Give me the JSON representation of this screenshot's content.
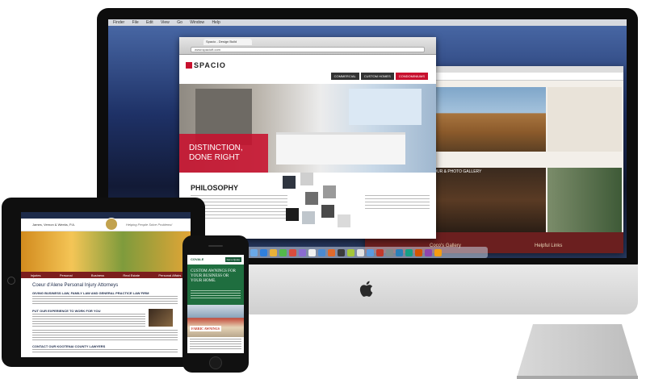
{
  "imac": {
    "menubar": [
      "Finder",
      "File",
      "Edit",
      "View",
      "Go",
      "Window",
      "Help"
    ],
    "dock_colors": [
      "#6aa9e9",
      "#2f7fdc",
      "#e8b23a",
      "#53b84b",
      "#d94c3d",
      "#8a6bd1",
      "#f1f1f1",
      "#4b8ad1",
      "#e06a2c",
      "#3b3b3b",
      "#a4c639",
      "#e2e2e2",
      "#5a9be0",
      "#c0392b",
      "#7f8c8d",
      "#2980b9",
      "#16a085",
      "#d35400",
      "#8e44ad",
      "#f39c12"
    ]
  },
  "spacio": {
    "tab": "Spacio - Design Build",
    "url": "www.spacioft.com",
    "logo": "SPACIO",
    "nav": [
      "COMMERCIAL",
      "CUSTOM HOMES",
      "CONDOMINIUMS"
    ],
    "hero_text": "DISTINCTION, DONE RIGHT",
    "section_title": "PHILOSOPHY",
    "tile_colors": [
      "#2f3540",
      "#cfcfcf",
      "#6e6e6e",
      "#1c1c1c",
      "#bfc6cc",
      "#4a4a4a",
      "#9a9a9a",
      "#dadada"
    ]
  },
  "gallery": {
    "gallery_title": "VIRTUAL TOUR & PHOTO GALLERY",
    "footer_left": "Coco's Gallery",
    "footer_right": "Helpful Links"
  },
  "ipad": {
    "firm_name": "James, Vernon & Weeks, P.A.",
    "tagline": "Helping People Solve Problems!",
    "nav": [
      "Injuries",
      "Personal",
      "Business",
      "Real Estate",
      "Personal Affairs"
    ],
    "page_title": "Coeur d'Alene Personal Injury Attorneys",
    "h1": "GIVING BUSINESS LAW, FAMILY LAW AND GENERAL PRACTICE LAW FIRM",
    "h2": "PUT OUR EXPERIENCE TO WORK FOR YOU",
    "h3": "CONTACT OUR KOOTENAI COUNTY LAWYERS"
  },
  "iphone": {
    "logo": "COVALE",
    "button": "Get a Quote",
    "headline": "CUSTOM AWNINGS FOR YOUR BUSINESS OR YOUR HOME.",
    "label": "FABRIC AWNINGS"
  }
}
